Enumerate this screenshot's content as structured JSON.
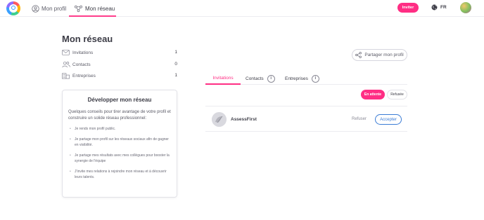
{
  "header": {
    "nav_profile": "Mon profil",
    "nav_network": "Mon réseau",
    "invite_button": "Inviter",
    "language": "FR"
  },
  "page": {
    "title": "Mon réseau"
  },
  "stats": [
    {
      "label": "Invitations",
      "count": "1",
      "icon": "mail-icon"
    },
    {
      "label": "Contacts",
      "count": "0",
      "icon": "users-icon"
    },
    {
      "label": "Entreprises",
      "count": "1",
      "icon": "building-icon"
    }
  ],
  "tips": {
    "title": "Développer mon réseau",
    "intro": "Quelques conseils pour tirer avantage de votre profil et construire un solide réseau professionnel:",
    "items": [
      "Je rends mon profil public.",
      "Je partage mon profil sur les réseaux sociaux afin de gagner en visibilité.",
      "Je partage mes résultats avec mes collègues pour booster la synergie de l'équipe",
      "J'invite mes relations à rejoindre mon réseau et à découvrir leurs talents."
    ]
  },
  "share_button": "Partager mon profil",
  "tabs": {
    "invitations": "Invitations",
    "contacts": "Contacts",
    "entreprises": "Entreprises",
    "info_glyph": "i"
  },
  "filters": {
    "pending": "En attente",
    "refused": "Refusée"
  },
  "invitation": {
    "name": "AssessFirst",
    "refuse": "Refuser",
    "accept": "Accepter"
  },
  "colors": {
    "accent": "#ff2e84",
    "link_blue": "#3a7bd5"
  }
}
